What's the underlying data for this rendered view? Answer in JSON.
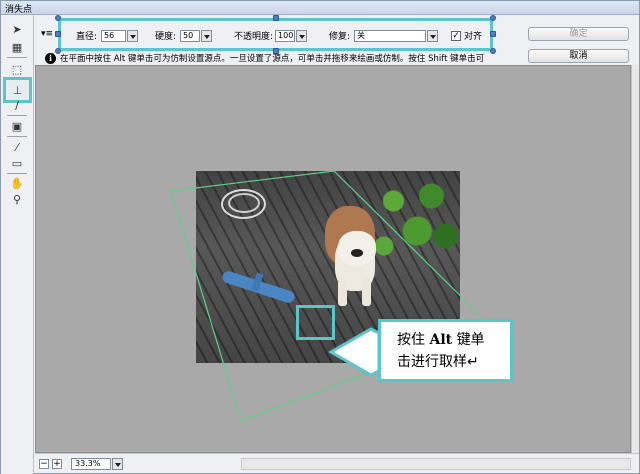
{
  "window": {
    "title": "消失点"
  },
  "options": {
    "diameter_label": "直径:",
    "diameter_value": "56",
    "hardness_label": "硬度:",
    "hardness_value": "50",
    "opacity_label": "不透明度:",
    "opacity_value": "100",
    "repair_label": "修复:",
    "repair_value": "关",
    "align_label": "对齐",
    "align_checked": true
  },
  "buttons": {
    "ok_label": "确定",
    "cancel_label": "取消"
  },
  "info": {
    "text": "在平面中按住 Alt 键单击可为仿制设置源点。一旦设置了源点，可单击并拖移来绘画或仿制。按住 Shift 键单击可"
  },
  "callout": {
    "line1_a": "按住",
    "line1_b": "Alt",
    "line1_c": "键单",
    "line2": "击进行取样↵"
  },
  "status": {
    "zoom_value": "33.3%",
    "zoom_out": "−",
    "zoom_in": "+"
  },
  "tools": [
    "select-arrow-icon",
    "create-plane-icon",
    "marquee-icon",
    "stamp-icon",
    "brush-icon",
    "transform-icon",
    "eyedropper-icon",
    "measure-icon",
    "hand-icon",
    "zoom-icon"
  ],
  "colors": {
    "highlight": "#5bc6c8",
    "plane_grid": "#5fcf8a"
  }
}
